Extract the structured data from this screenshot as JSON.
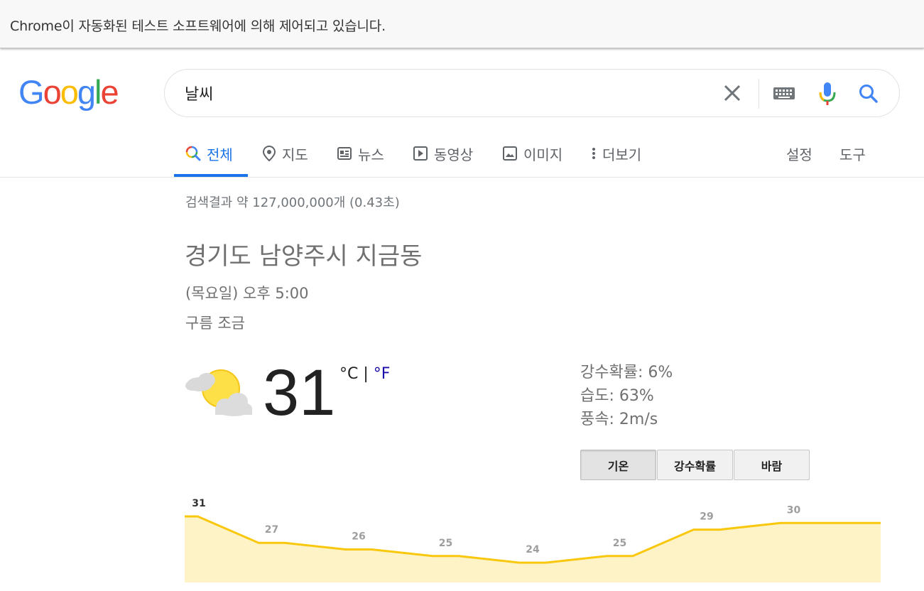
{
  "infobar": {
    "text": "Chrome이 자동화된 테스트 소프트웨어에 의해 제어되고 있습니다."
  },
  "logo": {
    "letters": [
      "G",
      "o",
      "o",
      "g",
      "l",
      "e"
    ]
  },
  "search": {
    "query": "날씨"
  },
  "tabs": [
    {
      "label": "전체",
      "active": true
    },
    {
      "label": "지도"
    },
    {
      "label": "뉴스"
    },
    {
      "label": "동영상"
    },
    {
      "label": "이미지"
    },
    {
      "label": "더보기"
    }
  ],
  "tools": {
    "settings": "설정",
    "tools": "도구"
  },
  "result_stats": "검색결과 약 127,000,000개 (0.43초)",
  "weather": {
    "location": "경기도 남양주시 지금동",
    "datetime": "(목요일) 오후 5:00",
    "condition": "구름 조금",
    "temperature": "31",
    "unit_c": "°C",
    "unit_sep": " | ",
    "unit_f": "°F",
    "precipitation": "강수확률: 6%",
    "humidity": "습도: 63%",
    "wind": "풍속: 2m/s",
    "segments": [
      {
        "label": "기온",
        "active": true
      },
      {
        "label": "강수확률"
      },
      {
        "label": "바람"
      }
    ],
    "colors": {
      "fill": "#fef3c7",
      "line": "#f9c80e",
      "label": "#9e9e9e",
      "label_first": "#333333"
    }
  },
  "chart_data": {
    "type": "area",
    "x": [
      0,
      1,
      2,
      3,
      4,
      5,
      6,
      7,
      8
    ],
    "values": [
      31,
      27,
      26,
      25,
      24,
      25,
      29,
      30,
      30
    ],
    "data_labels": [
      "31",
      "27",
      "26",
      "25",
      "24",
      "25",
      "29",
      "30",
      ""
    ],
    "grid": false,
    "xlabel": "",
    "ylabel": ""
  }
}
